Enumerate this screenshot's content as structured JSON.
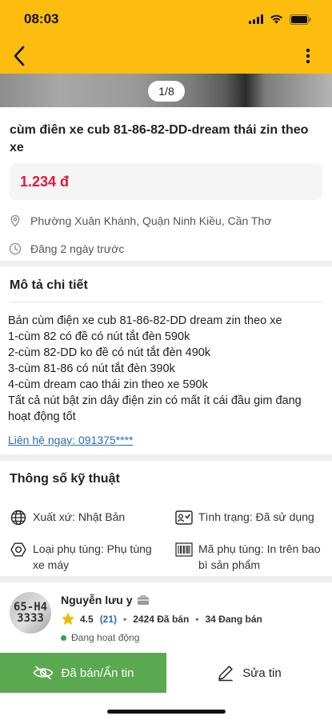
{
  "status_bar": {
    "time": "08:03"
  },
  "gallery": {
    "counter": "1/8"
  },
  "listing": {
    "title": "cùm điên xe cub 81-86-82-DD-dream thái zin theo xe",
    "price": "1.234 đ",
    "location": "Phường Xuân Khánh, Quận Ninh Kiều, Cần Thơ",
    "posted": "Đăng 2 ngày trước"
  },
  "description": {
    "heading": "Mô tả chi tiết",
    "lines": [
      "Bán cùm điện xe cub 81-86-82-DD dream zin theo xe",
      "1-cùm 82 có đề có nút tắt đèn 590k",
      "2-cùm 82-DD ko đề có nút tắt đèn 490k",
      "3-cùm 81-86 có nút tắt đèn 390k",
      "4-cùm dream cao thái zin theo xe 590k",
      "Tất cả nút bật zin dây điện zin có mất ít cái đầu gim đang hoạt động tốt"
    ],
    "contact": "Liên hệ ngay: 091375****"
  },
  "specs": {
    "heading": "Thông số kỹ thuật",
    "items": [
      {
        "label": "Xuất xứ: Nhật Bản",
        "icon": "globe-icon"
      },
      {
        "label": "Tình trạng: Đã sử dụng",
        "icon": "condition-icon"
      },
      {
        "label": "Loại phụ tùng: Phụ tùng xe máy",
        "icon": "nut-icon"
      },
      {
        "label": "Mã phụ tùng: In trên bao bì sản phẩm",
        "icon": "barcode-icon"
      }
    ]
  },
  "seller": {
    "name": "Nguyễn lưu y",
    "avatar_text": "65-H4 3333",
    "rating": "4.5",
    "rating_count": "(21)",
    "sold": "2424 Đã bán",
    "selling": "34 Đang bán",
    "status": "Đang hoạt động"
  },
  "actions": {
    "sold_hide": "Đã bán/Ẩn tin",
    "edit": "Sửa tin"
  },
  "colors": {
    "brand": "#fcbd0e",
    "price": "#e5173f",
    "sold_button": "#5aa84f",
    "link": "#2a6db0",
    "online": "#2aa84a"
  }
}
